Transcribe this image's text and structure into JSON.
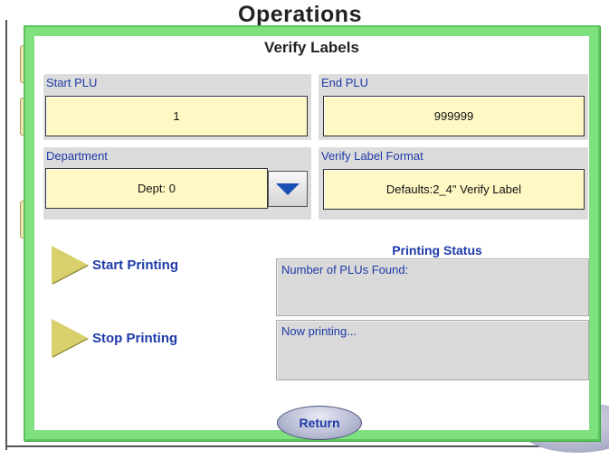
{
  "background": {
    "title": "Operations"
  },
  "dialog": {
    "title": "Verify Labels",
    "start_plu": {
      "label": "Start PLU",
      "value": "1"
    },
    "end_plu": {
      "label": "End PLU",
      "value": "999999"
    },
    "department": {
      "label": "Department",
      "value": "Dept: 0"
    },
    "label_format": {
      "label": "Verify Label Format",
      "value": "Defaults:2_4\" Verify Label"
    },
    "start_printing": "Start Printing",
    "stop_printing": "Stop Printing",
    "printing_status": {
      "title": "Printing Status",
      "plus_found": "Number of PLUs Found:",
      "now_printing": "Now printing..."
    },
    "return_label": "Return"
  },
  "colors": {
    "dialog_border": "#7fe07f",
    "label_text": "#1e3aa8",
    "value_field": "#fff8c4",
    "play_icon": "#d8d06c"
  },
  "icons": {
    "dropdown": "chevron-down-icon",
    "play": "play-icon"
  }
}
